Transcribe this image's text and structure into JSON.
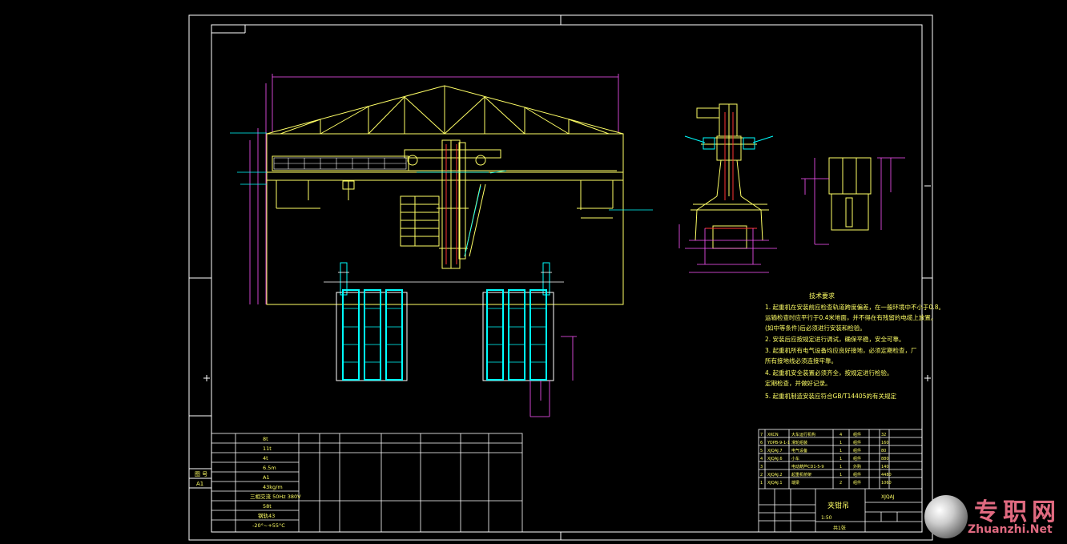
{
  "colors": {
    "frame": "#ffffff",
    "struct": "#ffff66",
    "dim": "#ff55ff",
    "cyan": "#00ffff",
    "red": "#ff3333",
    "white": "#ffffff"
  },
  "tech_requirements": {
    "title": "技术要求",
    "items": [
      "1. 起重机在安装前应检查轨道跨度偏差，在一般环境中不小于0.8。",
      "   运输检查时应平行于0.4米地面，并不得在有残留的电缆上放置。",
      "   (如中等条件)后必须进行安装和检验。",
      "2. 安装后应按规定进行调试，确保平稳，安全可靠。",
      "3. 起重机所有电气设备均应良好接地，必须定期检查，厂",
      "   所有接地线必须连接牢靠。",
      "4. 起重机安全装置必须齐全，按规定进行检验。",
      "   定期检查，并做好记录。",
      "5. 起重机制造安装应符合GB/T14405的有关规定"
    ]
  },
  "left_table": {
    "rows": [
      "8t",
      "11t",
      "4t",
      "6.5m",
      "A1",
      "43kg/m",
      "三相交流 50Hz 380V",
      "58t",
      "钢轨43",
      "-20°~+55°C"
    ]
  },
  "sidebar": {
    "label1": "图 号",
    "label2": "A1"
  },
  "bom": {
    "rows": [
      [
        "7",
        "XKCN",
        "大车运行机构",
        "4",
        "组件",
        "",
        "32"
      ],
      [
        "6",
        "YOPB-9-1-1",
        "滑轮组装",
        "1",
        "组件",
        "",
        "160"
      ],
      [
        "5",
        "XJQAJ.7",
        "电气设备",
        "1",
        "组件",
        "",
        "80"
      ],
      [
        "4",
        "XJQAJ.6",
        "小车",
        "1",
        "组件",
        "",
        "880"
      ],
      [
        "3",
        "",
        "电动葫芦CD1-5-9",
        "1",
        "外购",
        "",
        "140"
      ],
      [
        "2",
        "XJQAJ.2",
        "起重机桥架",
        "1",
        "组件",
        "",
        "4480"
      ],
      [
        "1",
        "XJQAJ.1",
        "端梁",
        "2",
        "组件",
        "",
        "1060"
      ]
    ]
  },
  "title_block": {
    "name": "夹钳吊",
    "drawing_no": "XJQAJ",
    "scale": "1:50",
    "sheet": "共1张"
  },
  "watermark": {
    "cn": "专职网",
    "en": "Zhuanzhi.Net"
  }
}
